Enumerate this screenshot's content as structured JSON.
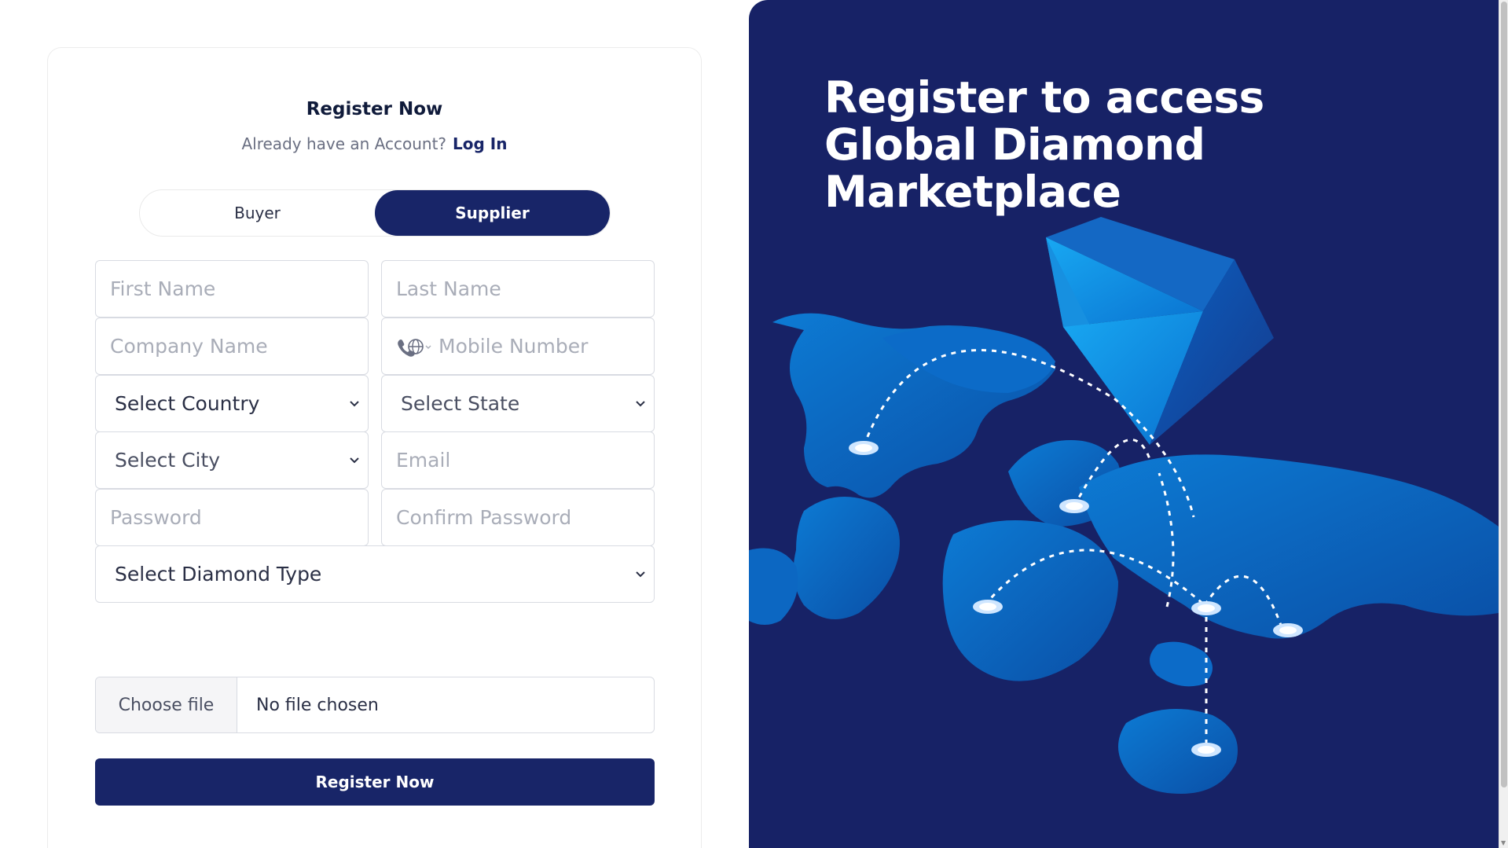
{
  "form": {
    "title": "Register Now",
    "account_prompt": "Already have an Account?",
    "login_link": "Log In",
    "tabs": [
      {
        "label": "Buyer",
        "active": false
      },
      {
        "label": "Supplier",
        "active": true
      }
    ],
    "fields": {
      "first_name": {
        "placeholder": "First Name"
      },
      "last_name": {
        "placeholder": "Last Name"
      },
      "company_name": {
        "placeholder": "Company Name"
      },
      "mobile_number": {
        "placeholder": "Mobile Number"
      },
      "country": {
        "value": "Select Country"
      },
      "state": {
        "value": "Select State"
      },
      "city": {
        "value": "Select City"
      },
      "email": {
        "placeholder": "Email"
      },
      "password": {
        "placeholder": "Password"
      },
      "confirm_password": {
        "placeholder": "Confirm Password"
      },
      "diamond_type": {
        "value": "Select Diamond Type"
      }
    },
    "file_input": {
      "button_label": "Choose file",
      "status": "No file chosen"
    },
    "submit_label": "Register Now"
  },
  "hero": {
    "heading": "Register to access Global Diamond Marketplace",
    "illustration": [
      "world-map",
      "diamond",
      "connection-pins"
    ]
  },
  "colors": {
    "primary": "#182568",
    "hero_background": "#172266",
    "map_blue": "#0a6fc4",
    "diamond_light": "#1fa6f0"
  },
  "icons": [
    "phone-globe-icon",
    "chevron-down-icon"
  ]
}
